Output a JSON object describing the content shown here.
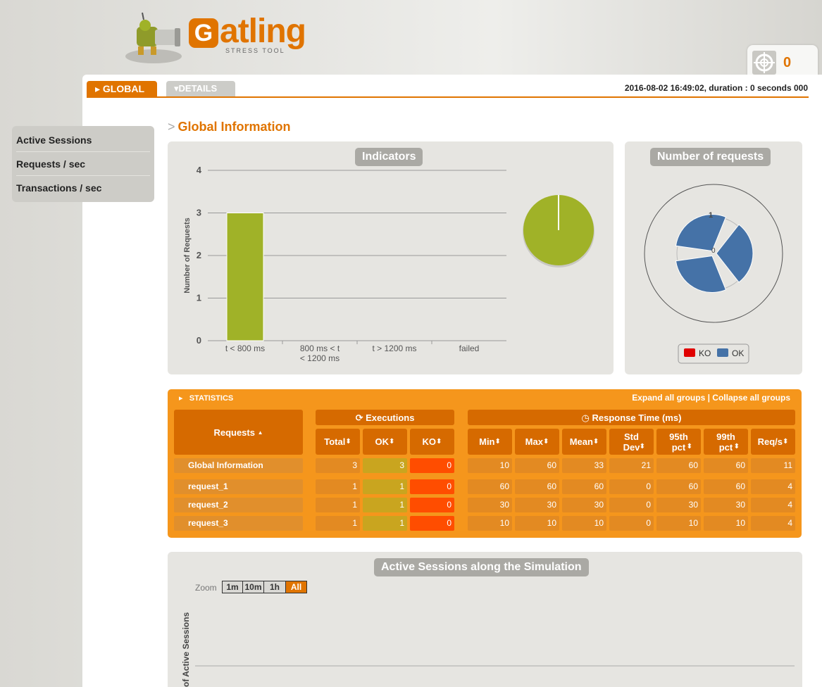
{
  "header": {
    "logo_word": "atling",
    "logo_letter": "G",
    "logo_subtitle": "STRESS TOOL",
    "ko_count": "0"
  },
  "tabs": {
    "global": "GLOBAL",
    "details": "DETAILS"
  },
  "run_info": "2016-08-02 16:49:02, duration : 0 seconds 000",
  "sidebar": {
    "items": [
      {
        "label": "Active Sessions"
      },
      {
        "label": "Requests / sec"
      },
      {
        "label": "Transactions / sec"
      }
    ]
  },
  "section_title": "Global Information",
  "indicators": {
    "title": "Indicators"
  },
  "requests_panel": {
    "title": "Number of requests",
    "scale_label": "1",
    "center_label": "0",
    "legend": [
      {
        "name": "KO",
        "color": "#e00000"
      },
      {
        "name": "OK",
        "color": "#4572a7"
      }
    ]
  },
  "chart_data": [
    {
      "type": "bar",
      "categories": [
        "t < 800 ms",
        "800 ms < t < 1200 ms",
        "t > 1200 ms",
        "failed"
      ],
      "values": [
        3,
        0,
        0,
        0
      ],
      "ylabel": "Number of Requests",
      "ylim": [
        0,
        4
      ],
      "yticks": [
        0,
        1,
        2,
        3,
        4
      ],
      "grid": true,
      "color": "#a0b228"
    },
    {
      "type": "pie",
      "labels": [
        "t < 800 ms",
        "800 ms < t < 1200 ms",
        "t > 1200 ms",
        "failed"
      ],
      "values": [
        3,
        0,
        0,
        0
      ],
      "color": "#a0b228"
    },
    {
      "type": "polar",
      "categories": [
        "request_1",
        "request_2",
        "request_3"
      ],
      "series": [
        {
          "name": "KO",
          "values": [
            0,
            0,
            0
          ],
          "color": "#e00000"
        },
        {
          "name": "OK",
          "values": [
            1,
            1,
            1
          ],
          "color": "#4572a7"
        }
      ],
      "legend": "bottom"
    },
    {
      "type": "line",
      "title": "Active Sessions along the Simulation",
      "ylabel": "of Active Sessions",
      "series": []
    }
  ],
  "statistics": {
    "title": "STATISTICS",
    "expand_label": "Expand all groups",
    "separator": " | ",
    "collapse_label": "Collapse all groups",
    "group_executions": "Executions",
    "group_response_time": "Response Time (ms)",
    "requests_header": "Requests",
    "sort_icon": "▲",
    "sort_both_icon": "⬍",
    "columns": {
      "total": "Total",
      "ok": "OK",
      "ko": "KO",
      "min": "Min",
      "max": "Max",
      "mean": "Mean",
      "std1": "Std",
      "std2": "Dev",
      "p95_1": "95th",
      "p95_2": "pct",
      "p99_1": "99th",
      "p99_2": "pct",
      "reqs": "Req/s"
    },
    "rows": [
      {
        "name": "Global Information",
        "total": "3",
        "ok": "3",
        "ko": "0",
        "min": "10",
        "max": "60",
        "mean": "33",
        "std": "21",
        "p95": "60",
        "p99": "60",
        "reqs": "11"
      },
      {
        "name": "request_1",
        "total": "1",
        "ok": "1",
        "ko": "0",
        "min": "60",
        "max": "60",
        "mean": "60",
        "std": "0",
        "p95": "60",
        "p99": "60",
        "reqs": "4"
      },
      {
        "name": "request_2",
        "total": "1",
        "ok": "1",
        "ko": "0",
        "min": "30",
        "max": "30",
        "mean": "30",
        "std": "0",
        "p95": "30",
        "p99": "30",
        "reqs": "4"
      },
      {
        "name": "request_3",
        "total": "1",
        "ok": "1",
        "ko": "0",
        "min": "10",
        "max": "10",
        "mean": "10",
        "std": "0",
        "p95": "10",
        "p99": "10",
        "reqs": "4"
      }
    ]
  },
  "active_sessions": {
    "title": "Active Sessions along the Simulation",
    "zoom_label": "Zoom",
    "zoom_options": [
      "1m",
      "10m",
      "1h",
      "All"
    ],
    "zoom_selected": "All",
    "ylabel": "of Active Sessions"
  },
  "colors": {
    "accent": "#e07400",
    "stats_bg": "#f5961c",
    "bar": "#a0b228",
    "ok": "#4572a7",
    "ko": "#e00000"
  }
}
